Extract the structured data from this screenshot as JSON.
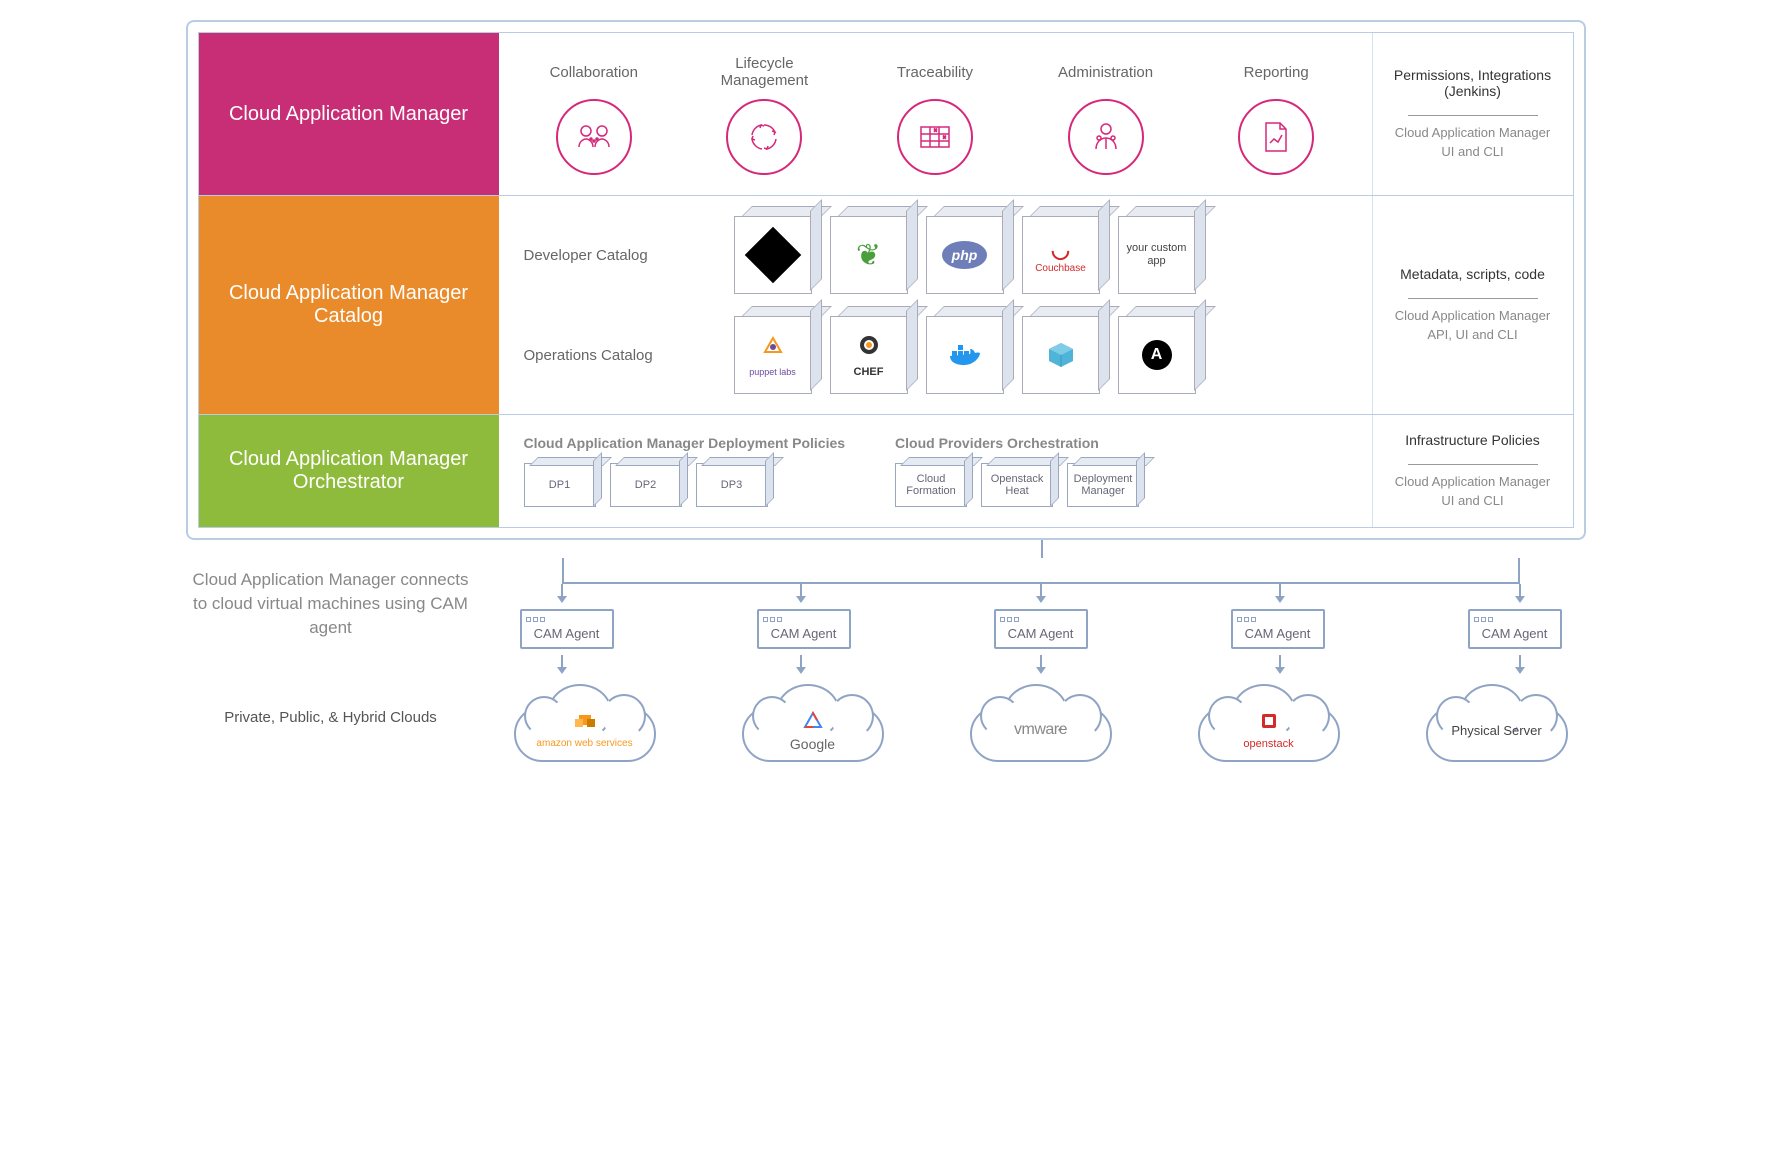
{
  "rows": {
    "cam": {
      "title": "Cloud Application Manager",
      "features": [
        {
          "label": "Collaboration",
          "icon": "collaboration-icon"
        },
        {
          "label": "Lifecycle Management",
          "icon": "lifecycle-icon"
        },
        {
          "label": "Traceability",
          "icon": "traceability-icon"
        },
        {
          "label": "Administration",
          "icon": "administration-icon"
        },
        {
          "label": "Reporting",
          "icon": "reporting-icon"
        }
      ],
      "sidebar": {
        "title": "Permissions, Integrations (Jenkins)",
        "sub": "Cloud Application Manager UI and CLI"
      }
    },
    "catalog": {
      "title": "Cloud Application Manager Catalog",
      "developer": {
        "label": "Developer Catalog",
        "items": [
          "git",
          "mongodb",
          "php",
          "Couchbase",
          "your custom app"
        ]
      },
      "operations": {
        "label": "Operations Catalog",
        "items": [
          "puppet labs",
          "CHEF",
          "docker",
          "package",
          "ansible"
        ]
      },
      "sidebar": {
        "title": "Metadata, scripts, code",
        "sub": "Cloud Application Manager API, UI and CLI"
      }
    },
    "orchestrator": {
      "title": "Cloud Application Manager Orchestrator",
      "policies": {
        "title": "Cloud Application Manager Deployment Policies",
        "items": [
          "DP1",
          "DP2",
          "DP3"
        ]
      },
      "providers": {
        "title": "Cloud Providers Orchestration",
        "items": [
          "Cloud Formation",
          "Openstack Heat",
          "Deployment Manager"
        ]
      },
      "sidebar": {
        "title": "Infrastructure Policies",
        "sub": "Cloud Application Manager UI and CLI"
      }
    }
  },
  "bottom": {
    "text": "Cloud Application Manager connects to cloud virtual machines using CAM agent",
    "sub": "Private, Public, & Hybrid Clouds",
    "agent_label": "CAM Agent",
    "clouds": [
      "amazon web services",
      "Google",
      "vmware",
      "openstack",
      "Physical Server"
    ]
  },
  "colors": {
    "pink": "#c82e76",
    "orange": "#e98b2a",
    "green": "#8fbb3d",
    "iconPink": "#d6287a",
    "line": "#8fa4c5"
  }
}
